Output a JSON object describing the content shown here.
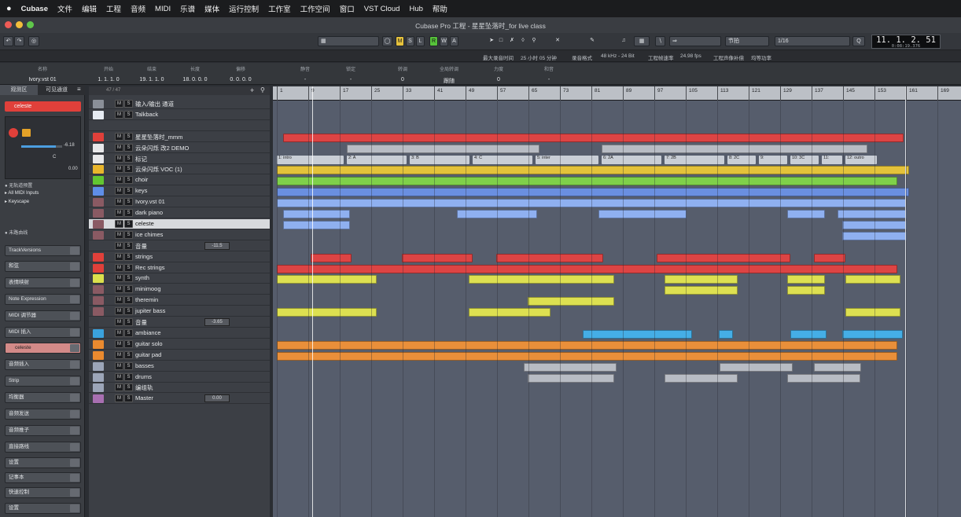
{
  "menubar": {
    "app": "Cubase",
    "items": [
      "文件",
      "编辑",
      "工程",
      "音频",
      "MIDI",
      "乐谱",
      "媒体",
      "运行控制",
      "工作室",
      "工作空间",
      "窗口",
      "VST Cloud",
      "Hub",
      "帮助"
    ]
  },
  "window": {
    "title": "Cubase Pro 工程 - 星星坠落时_for live class"
  },
  "transport": {
    "time_main": "11. 1. 2. 51",
    "time_sub": "0:08:19.376",
    "quantize": "1/16",
    "snap_mode": "节拍"
  },
  "statusline": {
    "max_rec_label": "最大录音时间",
    "max_rec": "25 小时 05 分钟",
    "rec_format_label": "录音格式",
    "rec_format": "48 kHz - 24 Bit",
    "frame_label": "工程帧速率",
    "frame": "24.98 fps",
    "pan_label": "工程声像补偿",
    "pan": "均等功率"
  },
  "infoline": [
    {
      "label": "名称",
      "value": "Ivory.vst 01"
    },
    {
      "label": "开始",
      "value": "1. 1. 1. 0"
    },
    {
      "label": "结束",
      "value": "19. 1. 1. 0"
    },
    {
      "label": "长度",
      "value": "18. 0. 0. 0"
    },
    {
      "label": "偏移",
      "value": "0. 0. 0. 0"
    },
    {
      "label": "静音",
      "value": "-"
    },
    {
      "label": "锁定",
      "value": "-"
    },
    {
      "label": "转调",
      "value": "0"
    },
    {
      "label": "全局转调",
      "value": "跟随"
    },
    {
      "label": "力度",
      "value": "0"
    },
    {
      "label": "和音",
      "value": "-"
    }
  ],
  "inspector": {
    "tabs": [
      "观测区",
      "可见通道"
    ],
    "track_name": "celeste",
    "volume": "-6.18",
    "pan": "C",
    "delay": "0.00",
    "input": "All MIDI Inputs",
    "instrument": "Keyscape",
    "routing": "未路由线",
    "no_track_label": "无轨道预置",
    "sections": [
      "TrackVersions",
      "和弦",
      "表情映射",
      "Note Expression",
      "MIDI 调节器",
      "MIDI 插入",
      "celeste",
      "音频插入",
      "Strip",
      "均衡器",
      "音频发送",
      "音频推子",
      "直接路线",
      "设置",
      "记事本",
      "快速控制",
      "设置"
    ]
  },
  "tracklist": {
    "count": "47 / 47",
    "tracks": [
      {
        "name": "输入/输出 通道",
        "color": "#8a8f98"
      },
      {
        "name": "Talkback",
        "color": "#e7ecf3"
      },
      {
        "name": "",
        "color": "#3c3f45"
      },
      {
        "name": "星星坠落时_mmm",
        "color": "#e0403a"
      },
      {
        "name": "云朵闪烁 改2 DEMO",
        "color": "#e8e8ea"
      },
      {
        "name": "标记",
        "color": "#e8e8ea"
      },
      {
        "name": "云朵闪烁 VOC (1)",
        "color": "#e9b62c"
      },
      {
        "name": "choir",
        "color": "#62c631"
      },
      {
        "name": "keys",
        "color": "#5f8ee8"
      },
      {
        "name": "Ivory.vst 01",
        "color": "#8a5a63"
      },
      {
        "name": "dark piano",
        "color": "#8a5a63"
      },
      {
        "name": "celeste",
        "color": "#8a5a63"
      },
      {
        "name": "ice chimes",
        "color": "#8a5a63"
      },
      {
        "name": "音量",
        "color": "#3c3f45"
      },
      {
        "name": "strings",
        "color": "#e0403a"
      },
      {
        "name": "Rec strings",
        "color": "#e0403a"
      },
      {
        "name": "synth",
        "color": "#dbe04c"
      },
      {
        "name": "minimoog",
        "color": "#8a5a63"
      },
      {
        "name": "theremin",
        "color": "#8a5a63"
      },
      {
        "name": "jupiter bass",
        "color": "#8a5a63"
      },
      {
        "name": "音量",
        "color": "#3c3f45"
      },
      {
        "name": "ambiance",
        "color": "#3aa2dd"
      },
      {
        "name": "guitar solo",
        "color": "#ea8a2f"
      },
      {
        "name": "guitar pad",
        "color": "#ea8a2f"
      },
      {
        "name": "basses",
        "color": "#9ca5b8"
      },
      {
        "name": "drums",
        "color": "#9ca5b8"
      },
      {
        "name": "编组轨",
        "color": "#9ca5b8"
      },
      {
        "name": "Master",
        "color": "#a86fb1"
      }
    ],
    "volume_values": [
      "-11.5",
      "-3.65",
      "0.00"
    ]
  },
  "ruler": [
    "1",
    "9",
    "17",
    "25",
    "33",
    "41",
    "49",
    "57",
    "65",
    "73",
    "81",
    "89",
    "97",
    "105",
    "113",
    "121",
    "129",
    "137",
    "145",
    "153",
    "161",
    "169"
  ],
  "markers": [
    "1: intro",
    "2: A",
    "3: B",
    "4: C",
    "5: inter",
    "6: 2A",
    "7: 2B",
    "8: 2C",
    "9:",
    "10: 3C",
    "11:",
    "12: outro"
  ],
  "colors": {
    "red": "#dd4444",
    "gray": "#b8bcc4",
    "yellow": "#e4c23a",
    "green": "#7fd04a",
    "blue": "#6a8fe0",
    "lightblue": "#8fb0f0",
    "lime": "#dde051",
    "cyan": "#45aee6",
    "orange": "#e98f3a"
  }
}
